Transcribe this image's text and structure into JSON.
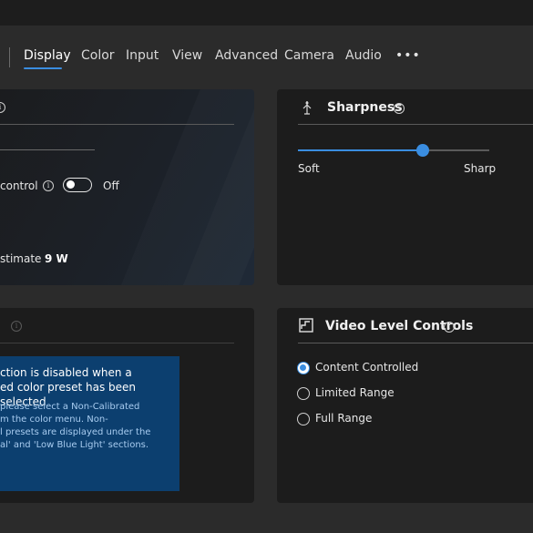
{
  "nav": {
    "tabs": [
      {
        "label": "Display",
        "active": true
      },
      {
        "label": "Color"
      },
      {
        "label": "Input"
      },
      {
        "label": "View"
      },
      {
        "label": "Advanced"
      },
      {
        "label": "Camera"
      },
      {
        "label": "Audio"
      }
    ],
    "more_label": "•••"
  },
  "power_panel": {
    "control_label": "control",
    "toggle_label": "Off",
    "toggle_on": false,
    "estimate_label": "stimate :",
    "estimate_value": "9 W"
  },
  "sharpness_panel": {
    "title": "Sharpness",
    "icon": "sharpness-icon",
    "min_label": "Soft",
    "max_label": "Sharp",
    "value_fraction": 0.65
  },
  "notice_panel": {
    "title_text": "ction is disabled when a\ned color preset has been selected",
    "body_text": " please select a Non-Calibrated\nm the color menu. Non-\nl presets are displayed under the\nal' and 'Low Blue Light' sections."
  },
  "video_level_panel": {
    "title": "Video Level Controls",
    "icon": "video-level-icon",
    "options": [
      {
        "label": "Content Controlled",
        "selected": true
      },
      {
        "label": "Limited Range",
        "selected": false
      },
      {
        "label": "Full Range",
        "selected": false
      }
    ]
  },
  "colors": {
    "accent": "#3a8de0",
    "background": "#2b2b2b",
    "panel": "#1c1c1c",
    "notice_bg": "#0c3f6f"
  }
}
